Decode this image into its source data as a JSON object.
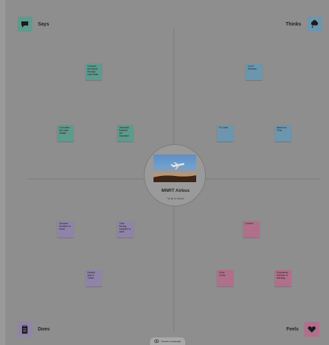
{
  "quadrants": {
    "says": {
      "label": "Says",
      "icon": "speech-bubble-icon",
      "color": "#5e9a8e"
    },
    "thinks": {
      "label": "Thinks",
      "icon": "thought-cloud-icon",
      "color": "#6c96ad"
    },
    "does": {
      "label": "Does",
      "icon": "clipboard-icon",
      "color": "#8f84a8"
    },
    "feels": {
      "label": "Feels",
      "icon": "heart-icon",
      "color": "#b0708c"
    }
  },
  "notes": {
    "says": [
      "Connect the airline through each state",
      "I too rates the route details",
      "Technical features are important"
    ],
    "thinks": [
      "Lot of Reviews",
      "To Costs",
      "Based on Time."
    ],
    "does": [
      "Shortest Duration to travel.",
      "Time Saving compare to other",
      "Easiest way to Travel."
    ],
    "feels": [
      "Comfort.",
      "Good Jonny.",
      "Experience and lots of learning."
    ]
  },
  "center": {
    "title": "MNRT  Airbus",
    "subtitle": "\"To fly To Serve\""
  },
  "footer": {
    "label": "Screen example",
    "icon": "eye-icon"
  }
}
